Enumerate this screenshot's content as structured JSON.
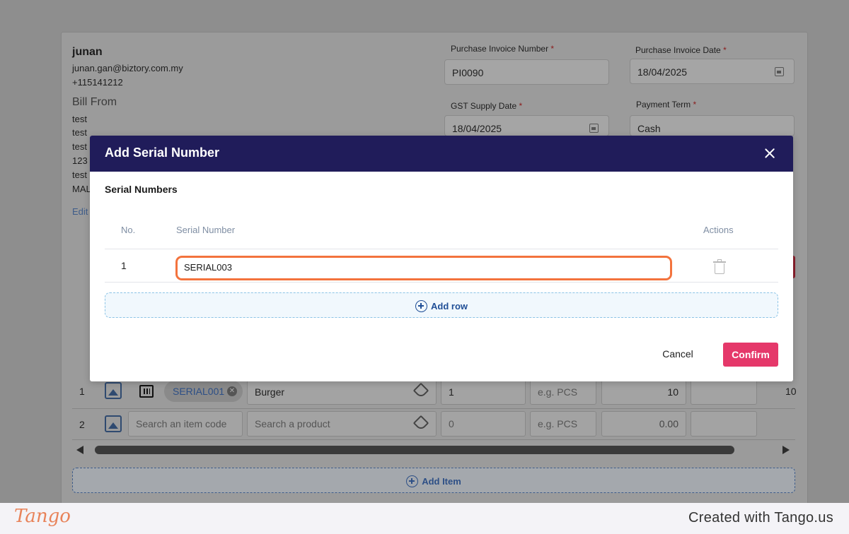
{
  "background": {
    "customer": {
      "name": "junan",
      "email": "junan.gan@biztory.com.my",
      "phone": "+115141212"
    },
    "bill_from": {
      "label": "Bill From",
      "lines": [
        "test",
        "test",
        "test",
        "123",
        "test",
        "MAL"
      ],
      "edit_label": "Edit"
    },
    "fields": {
      "purchase_invoice_number": {
        "label": "Purchase Invoice Number",
        "required_mark": "*",
        "value": "PI0090"
      },
      "purchase_invoice_date": {
        "label": "Purchase Invoice Date",
        "required_mark": "*",
        "value": "18/04/2025"
      },
      "gst_supply_date": {
        "label": "GST Supply Date",
        "required_mark": "*",
        "value": "18/04/2025"
      },
      "payment_term": {
        "label": "Payment Term",
        "required_mark": "*",
        "value": "Cash"
      }
    },
    "items": [
      {
        "no": "1",
        "serial_chip": "SERIAL001",
        "product": "Burger",
        "quantity": "1",
        "uom_placeholder": "e.g. PCS",
        "price": "10",
        "total": "10"
      },
      {
        "no": "2",
        "item_code_placeholder": "Search an item code",
        "product_placeholder": "Search a product",
        "quantity": "0",
        "uom_placeholder": "e.g. PCS",
        "price": "0.00"
      }
    ],
    "add_item_label": "Add Item"
  },
  "modal": {
    "title": "Add Serial Number",
    "section_title": "Serial Numbers",
    "columns": {
      "no": "No.",
      "serial": "Serial Number",
      "actions": "Actions"
    },
    "rows": [
      {
        "no": "1",
        "serial": "SERIAL003"
      }
    ],
    "add_row_label": "Add row",
    "cancel_label": "Cancel",
    "confirm_label": "Confirm"
  },
  "footer": {
    "logo_text": "Tango",
    "created_with": "Created with Tango.us"
  },
  "colors": {
    "modal_header": "#201c5a",
    "confirm_button": "#e5386a",
    "highlight": "#f3733d",
    "link_blue": "#1f4e96"
  }
}
